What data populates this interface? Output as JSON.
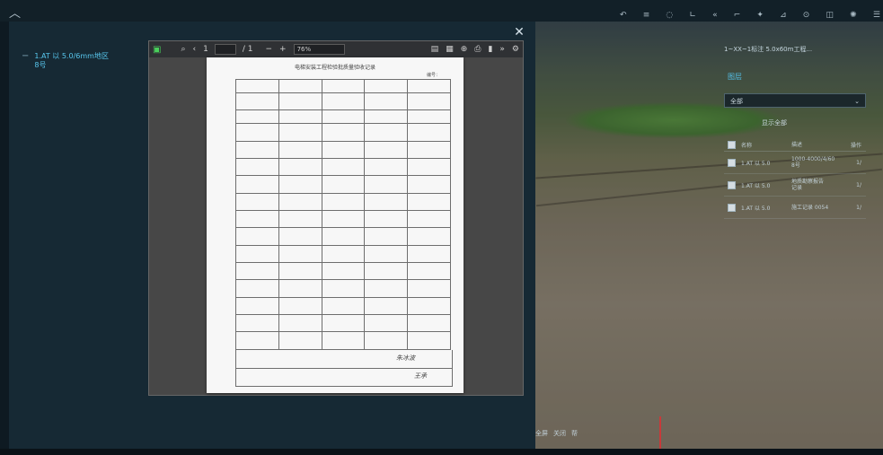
{
  "sidebar": {
    "item": "1.AT 以 5.0/6mm地区\n8号"
  },
  "viewer": {
    "page_current": "1",
    "page_total": "/ 1",
    "zoom": "76%",
    "doc_title": "电梯安装工程检验批质量验收记录",
    "doc_no": "编号：",
    "sig1": "朱冰波",
    "sig2": "王承"
  },
  "right_panel": {
    "title": "1~XX~1标注 5.0x60m工程...",
    "link": "图层",
    "select": "全部",
    "tag": "显示全部",
    "columns": [
      "名称",
      "描述",
      "操作"
    ],
    "rows": [
      {
        "name": "1.AT 以 5.0",
        "desc": "1000-4000/4/60\n8号",
        "op": "1/"
      },
      {
        "name": "1.AT 以 5.0",
        "desc": "地质勘察报告\n记录",
        "op": "1/"
      },
      {
        "name": "1.AT 以 5.0",
        "desc": "施工记录 0054",
        "op": "1/"
      }
    ]
  },
  "status": {
    "items": [
      "全屏",
      "关闭",
      "帮"
    ]
  }
}
